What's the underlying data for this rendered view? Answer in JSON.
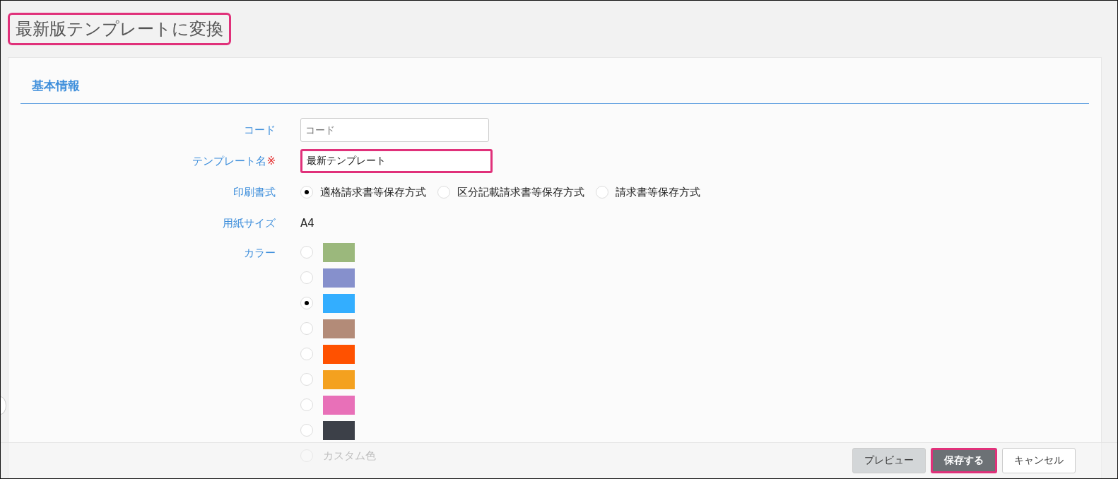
{
  "title": {
    "text": "最新版テンプレートに変換",
    "highlighted": true
  },
  "section": {
    "heading": "基本情報"
  },
  "form": {
    "rows": [
      {
        "kind": "text",
        "label": "コード",
        "placeholder": "コード",
        "highlighted": false
      },
      {
        "kind": "text",
        "label": "テンプレート名",
        "required_mark": "※",
        "value": "最新テンプレート",
        "highlighted": true
      },
      {
        "kind": "radio",
        "label": "印刷書式",
        "options": [
          {
            "label": "適格請求書等保存方式",
            "selected": true
          },
          {
            "label": "区分記載請求書等保存方式",
            "selected": false
          },
          {
            "label": "請求書等保存方式",
            "selected": false
          }
        ]
      },
      {
        "kind": "static",
        "label": "用紙サイズ",
        "value": "A4"
      },
      {
        "kind": "colors",
        "label": "カラー",
        "options": [
          {
            "kind": "swatch",
            "color": "#9bb87c",
            "selected": false
          },
          {
            "kind": "swatch",
            "color": "#8690cc",
            "selected": false
          },
          {
            "kind": "swatch",
            "color": "#33aeff",
            "selected": true
          },
          {
            "kind": "swatch",
            "color": "#b38b78",
            "selected": false
          },
          {
            "kind": "swatch",
            "color": "#ff5100",
            "selected": false
          },
          {
            "kind": "swatch",
            "color": "#f4a11f",
            "selected": false
          },
          {
            "kind": "swatch",
            "color": "#e870b8",
            "selected": false
          },
          {
            "kind": "swatch",
            "color": "#3c4048",
            "selected": false
          },
          {
            "kind": "custom",
            "label": "カスタム色",
            "selected": false
          }
        ]
      }
    ]
  },
  "footer": {
    "buttons": [
      {
        "label": "プレビュー",
        "kind": "secondary",
        "highlighted": false
      },
      {
        "label": "保存する",
        "kind": "primary",
        "highlighted": true
      },
      {
        "label": "キャンセル",
        "kind": "default",
        "highlighted": false
      }
    ]
  }
}
